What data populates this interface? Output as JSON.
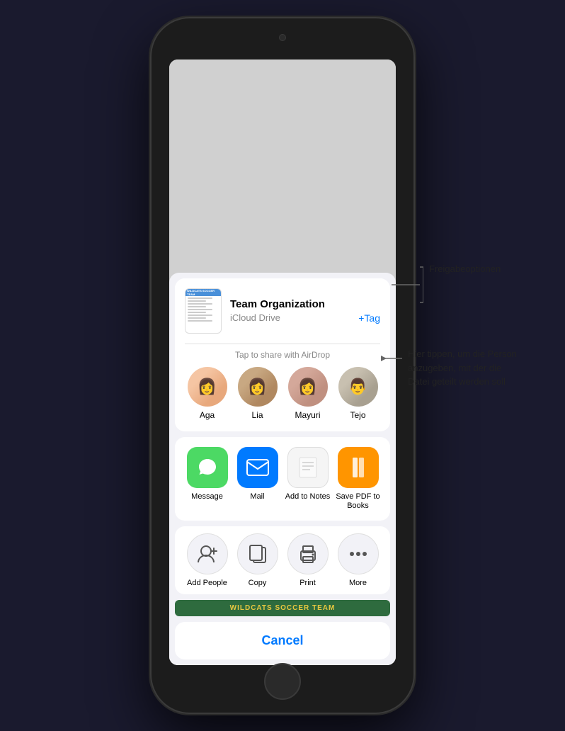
{
  "device": {
    "bg_color": "#1c1c1c"
  },
  "file_header": {
    "title": "Team Organization",
    "subtitle": "iCloud Drive",
    "tag_label": "+Tag"
  },
  "airdrop": {
    "label": "Tap to share with AirDrop",
    "contacts": [
      {
        "name": "Aga",
        "emoji": "👩"
      },
      {
        "name": "Lia",
        "emoji": "👩"
      },
      {
        "name": "Mayuri",
        "emoji": "👩"
      },
      {
        "name": "Tejo",
        "emoji": "👨"
      }
    ]
  },
  "share_options": {
    "items": [
      {
        "label": "Message",
        "icon_class": "icon-message"
      },
      {
        "label": "Mail",
        "icon_class": "icon-mail"
      },
      {
        "label": "Add to Notes",
        "icon_class": "icon-notes"
      },
      {
        "label": "Save PDF\nto Books",
        "icon_class": "icon-books"
      }
    ]
  },
  "action_options": {
    "items": [
      {
        "label": "Add People"
      },
      {
        "label": "Copy"
      },
      {
        "label": "Print"
      },
      {
        "label": "More"
      }
    ]
  },
  "wildcats_banner": "WILDCATS SOCCER TEAM",
  "cancel_label": "Cancel",
  "callouts": {
    "label1": "Freigabeoptionen",
    "label2": "Hier tippen, um die Person anzugeben, mit der die Datei geteilt werden soll"
  }
}
